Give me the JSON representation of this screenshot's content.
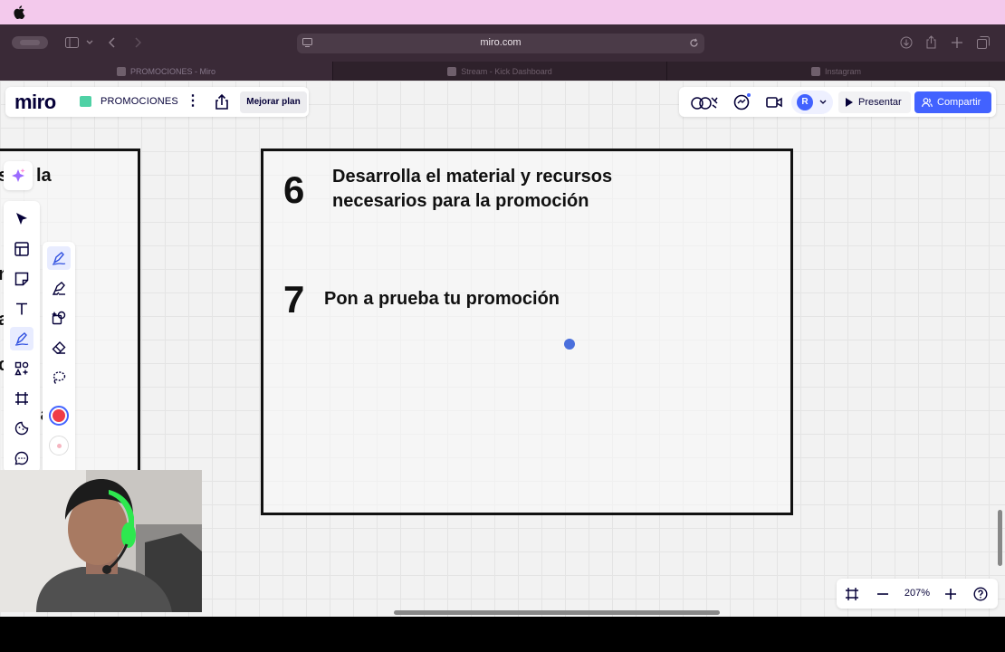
{
  "browser": {
    "address": "miro.com",
    "tabs": [
      {
        "title": "PROMOCIONES - Miro",
        "active": true
      },
      {
        "title": "Stream - Kick Dashboard",
        "active": false
      },
      {
        "title": "Instagram",
        "active": false
      }
    ]
  },
  "miro": {
    "logo": "miro",
    "board_name": "PROMOCIONES",
    "upgrade_label": "Mejorar plan",
    "avatar_initial": "R",
    "present_label": "Presentar",
    "share_label": "Compartir",
    "zoom_level": "207%",
    "accent_color": "#4262ff",
    "pen_color": "#ef3c47"
  },
  "canvas": {
    "left_frame_fragments": [
      "s",
      "la",
      "n",
      "a",
      "r",
      "c",
      "la"
    ],
    "steps": [
      {
        "number": "6",
        "text": "Desarrolla el material y recursos\nnecesarios para la promoción"
      },
      {
        "number": "7",
        "text": "Pon a prueba tu promoción"
      }
    ]
  },
  "toolbar": {
    "tools": [
      "select-icon",
      "templates-icon",
      "sticky-note-icon",
      "text-icon",
      "pen-icon",
      "shapes-icon",
      "frame-icon",
      "stickers-icon",
      "comment-icon"
    ],
    "pen_tools": [
      "pen-icon",
      "highlighter-icon",
      "smart-drawing-icon",
      "eraser-icon",
      "lasso-icon"
    ]
  }
}
